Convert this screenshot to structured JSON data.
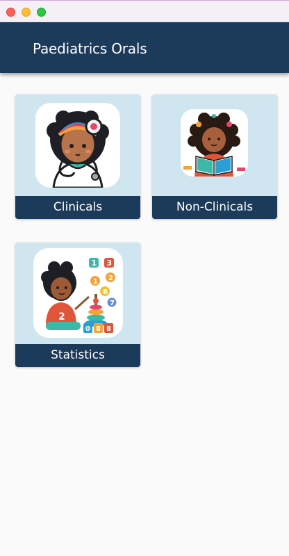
{
  "window": {
    "controls": [
      "close",
      "minimize",
      "maximize"
    ]
  },
  "appbar": {
    "title": "Paediatrics Orals"
  },
  "cards": [
    {
      "label": "Clinicals",
      "icon": "child-doctor-stethoscope-icon"
    },
    {
      "label": "Non-Clinicals",
      "icon": "child-reading-book-icon"
    },
    {
      "label": "Statistics",
      "icon": "child-numbers-toys-icon"
    }
  ],
  "statistics_numbers": [
    "1",
    "3",
    "1",
    "2",
    "6",
    "7",
    "2",
    "0",
    "8",
    "8"
  ],
  "colors": {
    "appbar": "#1c3a5a",
    "card_background": "#cfe6f1",
    "page_background": "#fafafa"
  }
}
